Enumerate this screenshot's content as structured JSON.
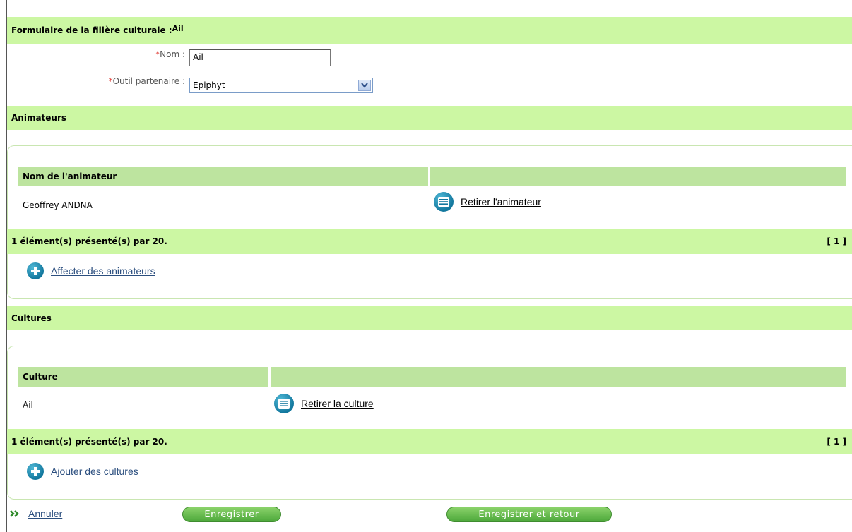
{
  "form": {
    "title_prefix": "Formulaire de la filière culturale :",
    "title_value": "Ail",
    "required_mark": "*",
    "nom_label": "Nom :",
    "nom_value": "Ail",
    "outil_label": "Outil partenaire :",
    "outil_value": "Epiphyt"
  },
  "animateurs": {
    "section_title": "Animateurs",
    "col_header": "Nom de l'animateur",
    "rows": [
      {
        "name": "Geoffrey ANDNA",
        "action": "Retirer l'animateur"
      }
    ],
    "summary": "1 élément(s) présenté(s) par 20.",
    "pager": "[ 1 ]",
    "add_link": "Affecter des animateurs"
  },
  "cultures": {
    "section_title": "Cultures",
    "col_header": "Culture",
    "rows": [
      {
        "name": "Ail",
        "action": "Retirer la culture"
      }
    ],
    "summary": "1 élément(s) présenté(s) par 20.",
    "pager": "[ 1 ]",
    "add_link": "Ajouter des cultures"
  },
  "footer": {
    "cancel": "Annuler",
    "save": "Enregistrer",
    "save_return": "Enregistrer et retour"
  },
  "colors": {
    "section_bar": "#ccf7a3",
    "table_header": "#bde49f",
    "button_green": "#4da83b",
    "link_blue": "#2c4f7f",
    "required_red": "#e0403a"
  },
  "icons": [
    "list-remove-icon",
    "add-icon",
    "chevron-down-icon",
    "double-chevron-right-icon"
  ]
}
